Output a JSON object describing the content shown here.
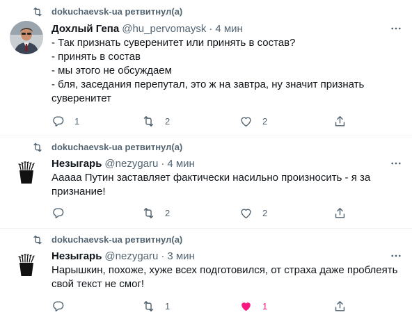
{
  "tweets": [
    {
      "retweeted_by": "dokuchaevsk-ua ретвитнул(а)",
      "name": "Дохлый Гепа",
      "handle": "@hu_pervomaysk",
      "dot": "·",
      "time": "4 мин",
      "avatar": "person-photo",
      "lines": [
        "- Так признать суверенитет или принять в состав?",
        "- принять в состав",
        "- мы этого не обсуждаем",
        "- бля, заседания перепутал, это ж на завтра, ну значит признать",
        "суверенитет"
      ],
      "replies": "1",
      "retweets": "2",
      "likes": "2",
      "liked": false
    },
    {
      "retweeted_by": "dokuchaevsk-ua ретвитнул(а)",
      "name": "Незыгарь",
      "handle": "@nezygaru",
      "dot": "·",
      "time": "4 мин",
      "avatar": "shot-glass-logo",
      "lines": [
        "Ааааа Путин заставляет фактически насильно произносить - я за",
        "признание!"
      ],
      "replies": "",
      "retweets": "2",
      "likes": "2",
      "liked": false
    },
    {
      "retweeted_by": "dokuchaevsk-ua ретвитнул(а)",
      "name": "Незыгарь",
      "handle": "@nezygaru",
      "dot": "·",
      "time": "3 мин",
      "avatar": "shot-glass-logo",
      "lines": [
        "Нарышкин, похоже, хуже всех подготовился, от страха даже проблеять",
        "свой текст не смог!"
      ],
      "replies": "",
      "retweets": "1",
      "likes": "1",
      "liked": true
    }
  ],
  "colors": {
    "secondary_text": "#536471",
    "primary_text": "#0f1419",
    "like_active": "#f91880",
    "divider": "#eff3f4"
  }
}
